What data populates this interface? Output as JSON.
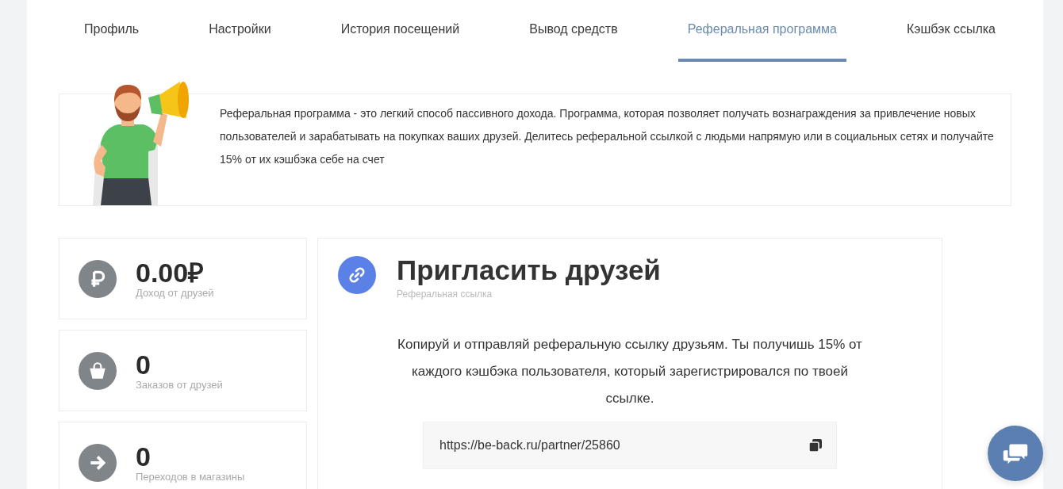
{
  "tabs": [
    {
      "label": "Профиль",
      "selected": false
    },
    {
      "label": "Настройки",
      "selected": false
    },
    {
      "label": "История посещений",
      "selected": false
    },
    {
      "label": "Вывод средств",
      "selected": false
    },
    {
      "label": "Реферальная программа",
      "selected": true
    },
    {
      "label": "Кэшбэк ссылка",
      "selected": false
    }
  ],
  "intro": {
    "text": "Реферальная программа - это легкий способ пассивного дохода. Программа, которая позволяет получать вознаграждения за привлечение новых пользователей и зарабатывать на покупках ваших друзей. Делитесь реферальной ссылкой с людьми напрямую или в социальных сетях и получайте 15% от их кэшбэка себе на счет"
  },
  "stats": [
    {
      "kind": "ruble",
      "value": "0.00₽",
      "label": "Доход от друзей"
    },
    {
      "kind": "basket",
      "value": "0",
      "label": "Заказов от друзей"
    },
    {
      "kind": "arrow",
      "value": "0",
      "label": "Переходов в магазины"
    }
  ],
  "invite": {
    "title": "Пригласить друзей",
    "subtitle": "Реферальная ссылка",
    "description": "Копируй и отправляй реферальную ссылку друзьям. Ты получишь 15% от каждого кэшбэка пользователя, который зарегистрировался по твоей ссылке.",
    "link": "https://be-back.ru/partner/25860"
  }
}
